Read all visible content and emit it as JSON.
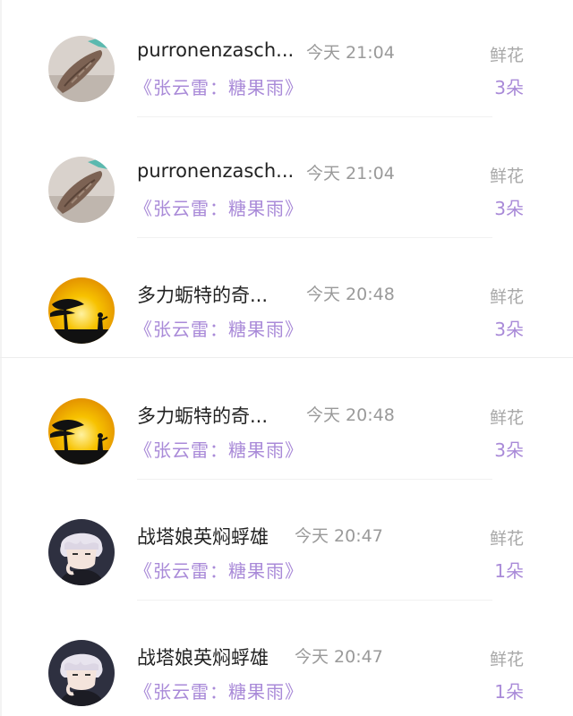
{
  "rows": [
    {
      "name": "purronenzasch...",
      "time": "今天 21:04",
      "book": "《张云雷：糖果雨》",
      "gift_label": "鲜花",
      "gift_count": "3朵",
      "avatar": "shell-avatar"
    },
    {
      "name": "purronenzasch...",
      "time": "今天 21:04",
      "book": "《张云雷：糖果雨》",
      "gift_label": "鲜花",
      "gift_count": "3朵",
      "avatar": "shell-avatar"
    },
    {
      "name": "多力蛎特的奇...",
      "time": "今天 20:48",
      "book": "《张云雷：糖果雨》",
      "gift_label": "鲜花",
      "gift_count": "3朵",
      "avatar": "sunset-avatar"
    },
    {
      "name": "多力蛎特的奇...",
      "time": "今天 20:48",
      "book": "《张云雷：糖果雨》",
      "gift_label": "鲜花",
      "gift_count": "3朵",
      "avatar": "sunset-avatar"
    },
    {
      "name": "战塔娘英焖蜉雄",
      "time": "今天 20:47",
      "book": "《张云雷：糖果雨》",
      "gift_label": "鲜花",
      "gift_count": "1朵",
      "avatar": "anime-boy-avatar"
    },
    {
      "name": "战塔娘英焖蜉雄",
      "time": "今天 20:47",
      "book": "《张云雷：糖果雨》",
      "gift_label": "鲜花",
      "gift_count": "1朵",
      "avatar": "anime-boy-avatar"
    }
  ],
  "colors": {
    "accent_purple": "#a98ad8",
    "name_text": "#222222",
    "muted_text": "#9a9a9a",
    "sunset_yellow": "#f5b800",
    "shell_bg": "#d9d2cc"
  }
}
